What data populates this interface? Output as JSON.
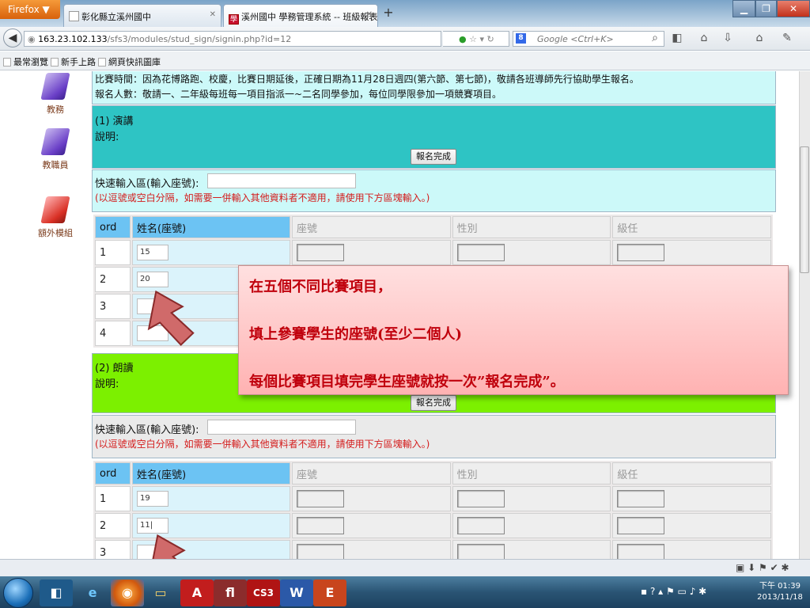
{
  "browser": {
    "menu_label": "Firefox ▼",
    "tabs": [
      {
        "label": "彰化縣立溪州國中"
      },
      {
        "label": "溪州國中 學務管理系統 -- 班級報表單",
        "icon": "學"
      }
    ],
    "new_tab_label": "+",
    "url_host": "163.23.102.133",
    "url_path": "/sfs3/modules/stud_sign/signin.php?id=12",
    "search_placeholder": "Google <Ctrl+K>",
    "bookmarks": [
      "最常瀏覽",
      "新手上路",
      "網頁快訊圖庫"
    ]
  },
  "sidebar": {
    "items": [
      {
        "label": "教務",
        "icon": "purple-book-icon"
      },
      {
        "label": "教職員",
        "icon": "purple-book-icon"
      },
      {
        "label": "額外模組",
        "icon": "red-book-icon"
      }
    ]
  },
  "page": {
    "intro_line1": "比賽時間：因為花博路跑、校慶，比賽日期延後，正確日期為11月28日週四(第六節、第七節)，敬請各班導師先行協助學生報名。",
    "intro_line2": "報名人數：敬請一、二年級每班每一項目指派一~二名同學參加，每位同學限參加一項競賽項目。",
    "sections": [
      {
        "title": "(1) 演講",
        "desc_label": "說明:",
        "finish_label": "報名完成",
        "quick_label": "快速輸入區(輸入座號):",
        "quick_note": "(以逗號或空白分隔，如需要一併輸入其他資料者不適用，請使用下方區塊輸入。)",
        "headers": [
          "ord",
          "姓名(座號)",
          "座號",
          "性別",
          "級任"
        ],
        "rows": [
          {
            "ord": "1",
            "seat": "15"
          },
          {
            "ord": "2",
            "seat": "20"
          },
          {
            "ord": "3",
            "seat": ""
          },
          {
            "ord": "4",
            "seat": ""
          }
        ]
      },
      {
        "title": "(2) 朗讀",
        "desc_label": "說明:",
        "finish_label": "報名完成",
        "quick_label": "快速輸入區(輸入座號):",
        "quick_note": "(以逗號或空白分隔，如需要一併輸入其他資料者不適用，請使用下方區塊輸入。)",
        "headers": [
          "ord",
          "姓名(座號)",
          "座號",
          "性別",
          "級任"
        ],
        "rows": [
          {
            "ord": "1",
            "seat": "19"
          },
          {
            "ord": "2",
            "seat": "11|"
          },
          {
            "ord": "3",
            "seat": ""
          }
        ]
      }
    ]
  },
  "callout": {
    "line1": "在五個不同比賽項目，",
    "line2": "填上參賽學生的座號(至少二個人)",
    "line3": "每個比賽項目填完學生座號就按一次”報名完成”。"
  },
  "taskbar": {
    "time": "下午 01:39",
    "date": "2013/11/18",
    "apps": [
      "ie-icon",
      "firefox-icon",
      "folder-icon",
      "acrobat-icon",
      "flash-icon",
      "photoshop-cs3-icon",
      "word-icon",
      "calendar-icon"
    ]
  },
  "colors": {
    "section1_band": "#2ec4c4",
    "section2_band": "#7cf000",
    "light_band": "#ccf9f9",
    "header_blue": "#6cc3f3",
    "callout_text": "#c0000c"
  }
}
